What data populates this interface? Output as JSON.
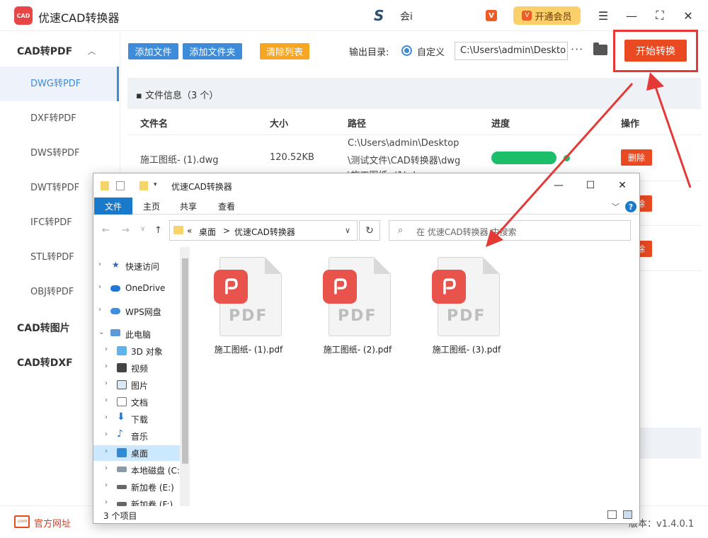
{
  "app": {
    "title": "优速CAD转换器",
    "logo": "CAD",
    "username": "会i",
    "vip_button": "开通会员"
  },
  "toolbar": {
    "add_file": "添加文件",
    "add_folder": "添加文件夹",
    "clear_list": "清除列表",
    "output_dir_label": "输出目录:",
    "custom_label": "自定义",
    "output_path": "C:\\Users\\admin\\Deskto",
    "more": "···",
    "start": "开始转换"
  },
  "sidebar": {
    "groups": [
      {
        "label": "CAD转PDF",
        "items": [
          "DWG转PDF",
          "DXF转PDF",
          "DWS转PDF",
          "DWT转PDF",
          "IFC转PDF",
          "STL转PDF",
          "OBJ转PDF"
        ],
        "active": "DWG转PDF"
      },
      {
        "label": "CAD转图片"
      },
      {
        "label": "CAD转DXF"
      }
    ]
  },
  "fileinfo": {
    "title": "文件信息（3 个）"
  },
  "table": {
    "headers": [
      "文件名",
      "大小",
      "路径",
      "进度",
      "操作"
    ],
    "rows": [
      {
        "name": "施工图纸- (1).dwg",
        "size": "120.52KB",
        "path": [
          "C:\\Users\\admin\\Desktop",
          "\\测试文件\\CAD转换器\\dwg",
          "\\施工图纸- (1).dwg"
        ],
        "progress": 1.0,
        "action": "删除"
      },
      {
        "action": "删除"
      },
      {
        "action": "删除"
      }
    ]
  },
  "footer": {
    "site_label": "官方网址",
    "site_icon_text": ".com",
    "version": "版本：v1.4.0.1"
  },
  "explorer": {
    "title": "优速CAD转换器",
    "ribbon_tabs": [
      "文件",
      "主页",
      "共享",
      "查看"
    ],
    "breadcrumb": [
      "«",
      "桌面",
      ">",
      "优速CAD转换器"
    ],
    "search_placeholder": "在 优速CAD转换器 中搜索",
    "nav_items": [
      "快速访问",
      "OneDrive",
      "WPS网盘",
      "此电脑",
      "3D 对象",
      "视频",
      "图片",
      "文档",
      "下载",
      "音乐",
      "桌面",
      "本地磁盘 (C:",
      "新加卷 (E:)",
      "新加卷 (F:)"
    ],
    "files": [
      "施工图纸- (1).pdf",
      "施工图纸- (2).pdf",
      "施工图纸- (3).pdf"
    ],
    "pdf_label": "PDF",
    "status": "3 个项目"
  },
  "colors": {
    "primary": "#3d8bd9",
    "danger": "#e94a22",
    "orange": "#f6a623",
    "success": "#1dbe6a",
    "pdf_red": "#e8544b",
    "annotation": "#e53935"
  }
}
